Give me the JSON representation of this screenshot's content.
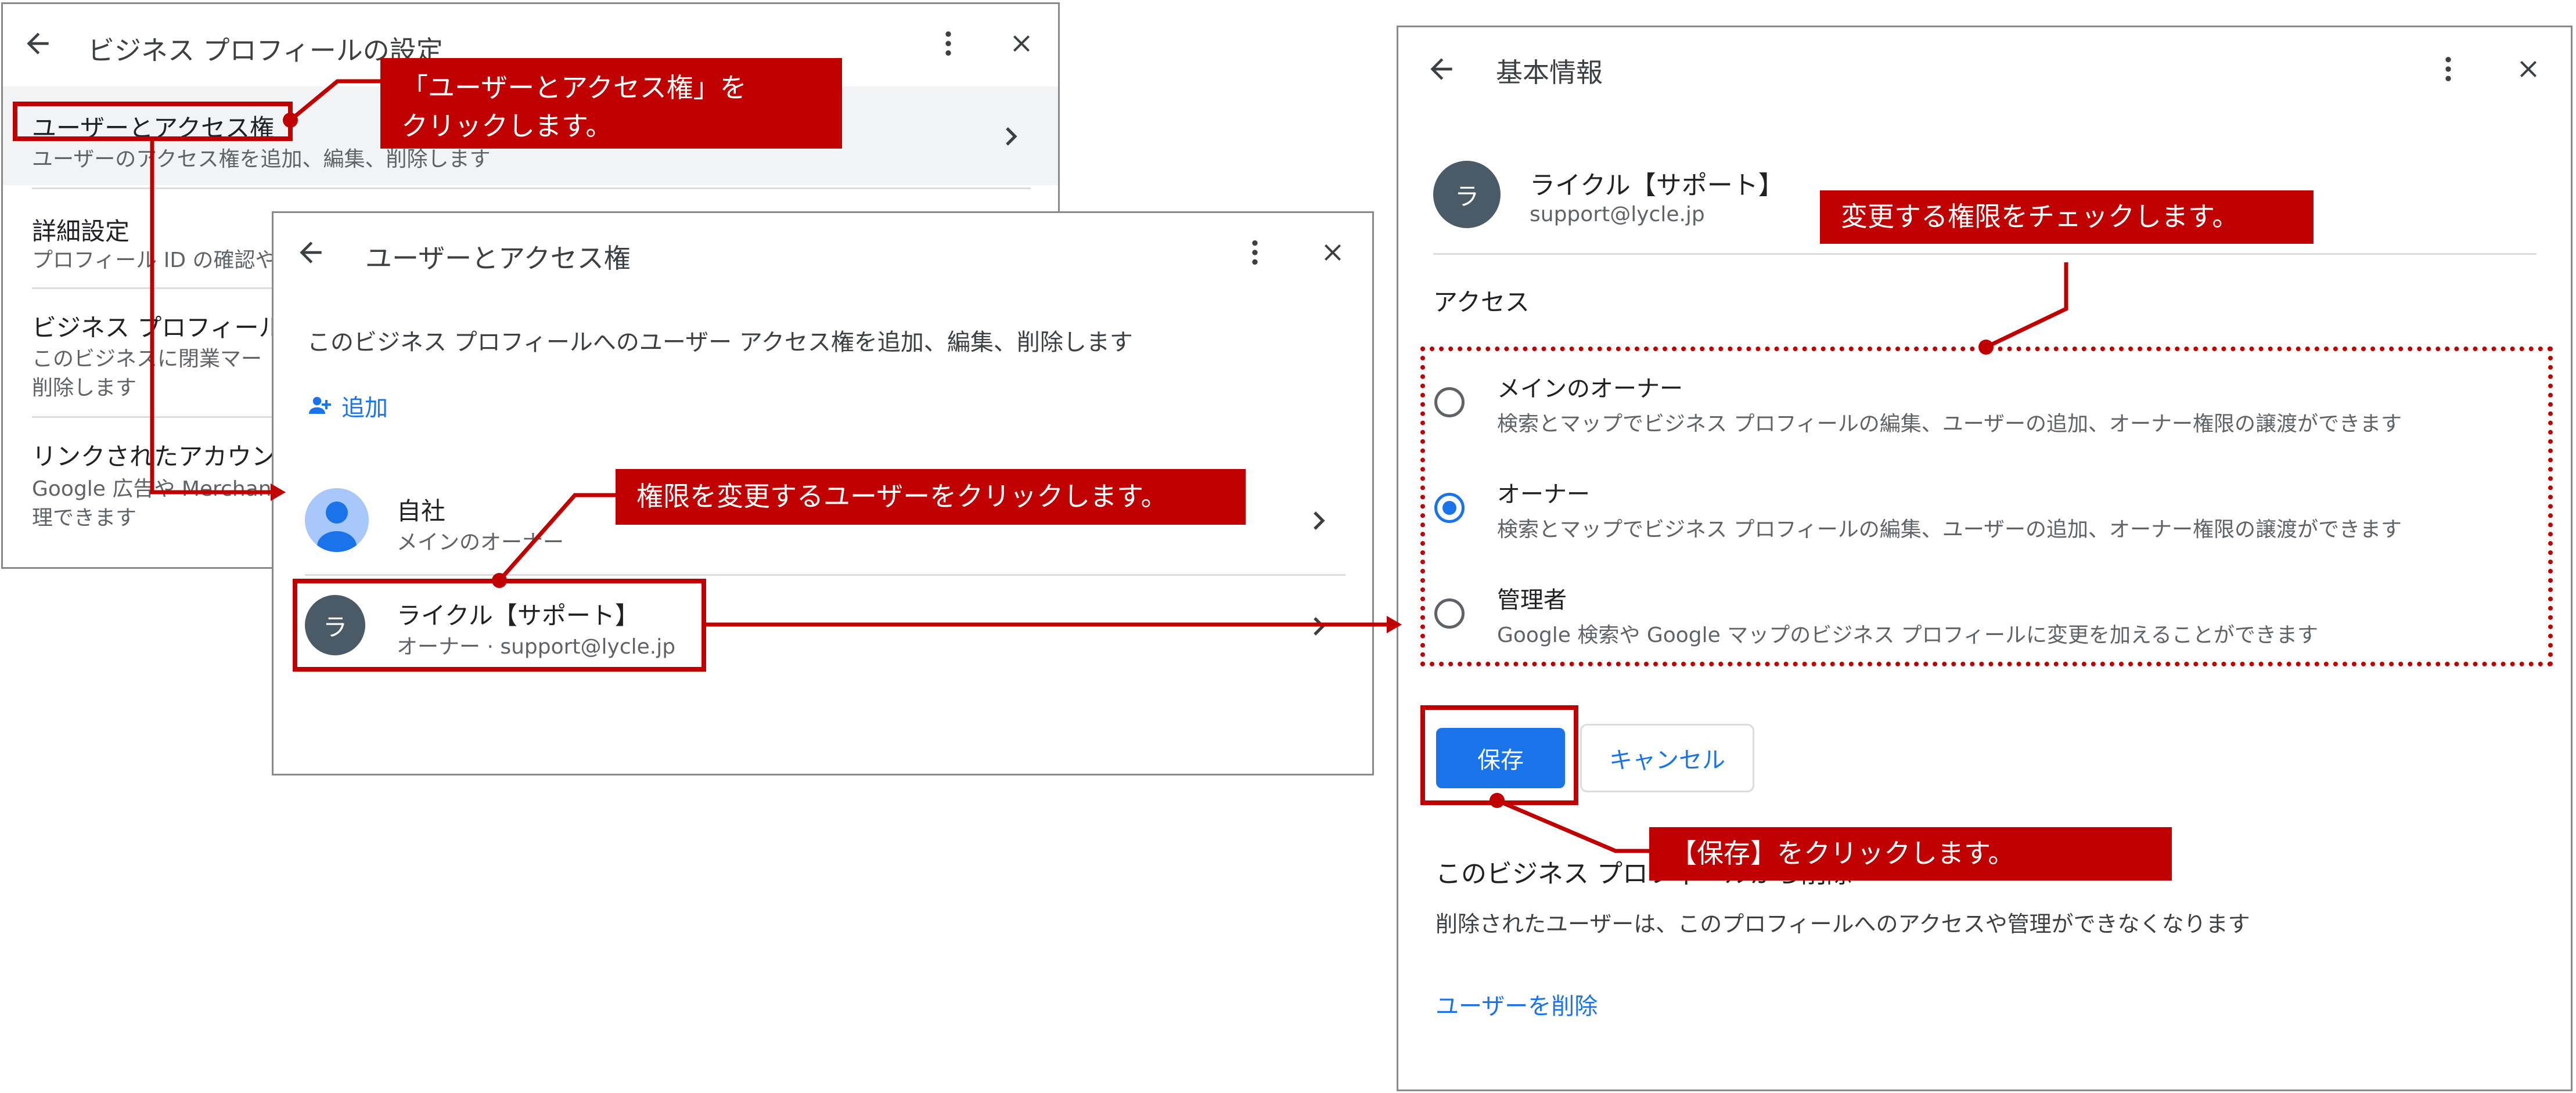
{
  "panel1": {
    "title": "ビジネス プロフィールの設定",
    "items": [
      {
        "title": "ユーザーとアクセス権",
        "desc": "ユーザーのアクセス権を追加、編集、削除します"
      },
      {
        "title": "詳細設定",
        "desc": "プロフィール ID の確認や"
      },
      {
        "title": "ビジネス プロフィール",
        "desc1": "このビジネスに閉業マー",
        "desc2": "削除します"
      },
      {
        "title": "リンクされたアカウン",
        "desc1": "Google 広告や Merchant",
        "desc2": "理できます"
      }
    ]
  },
  "panel2": {
    "title": "ユーザーとアクセス権",
    "description": "このビジネス プロフィールへのユーザー アクセス権を追加、編集、削除します",
    "add_label": "追加",
    "users": [
      {
        "name": "自社",
        "role": "メインのオーナー"
      },
      {
        "name": "ライクル【サポート】",
        "role": "オーナー · support@lycle.jp",
        "initial": "ラ"
      }
    ]
  },
  "panel3": {
    "title": "基本情報",
    "user": {
      "initial": "ラ",
      "name": "ライクル【サポート】",
      "email": "support@lycle.jp"
    },
    "access_label": "アクセス",
    "options": [
      {
        "label": "メインのオーナー",
        "desc": "検索とマップでビジネス プロフィールの編集、ユーザーの追加、オーナー権限の譲渡ができます",
        "selected": false
      },
      {
        "label": "オーナー",
        "desc": "検索とマップでビジネス プロフィールの編集、ユーザーの追加、オーナー権限の譲渡ができます",
        "selected": true
      },
      {
        "label": "管理者",
        "desc": "Google 検索や Google マップのビジネス プロフィールに変更を加えることができます",
        "selected": false
      }
    ],
    "save_label": "保存",
    "cancel_label": "キャンセル",
    "remove_section_title": "このビジネス プロフィールから削除",
    "remove_desc": "削除されたユーザーは、このプロフィールへのアクセスや管理ができなくなります",
    "remove_link": "ユーザーを削除"
  },
  "callouts": {
    "c1_line1": "「ユーザーとアクセス権」を",
    "c1_line2": "クリックします。",
    "c2": "権限を変更するユーザーをクリックします。",
    "c3": "変更する権限をチェックします。",
    "c4": "【保存】をクリックします。"
  },
  "colors": {
    "accent": "#1a73e8",
    "annotation": "#c00000",
    "avatar": "#4a5a66"
  }
}
